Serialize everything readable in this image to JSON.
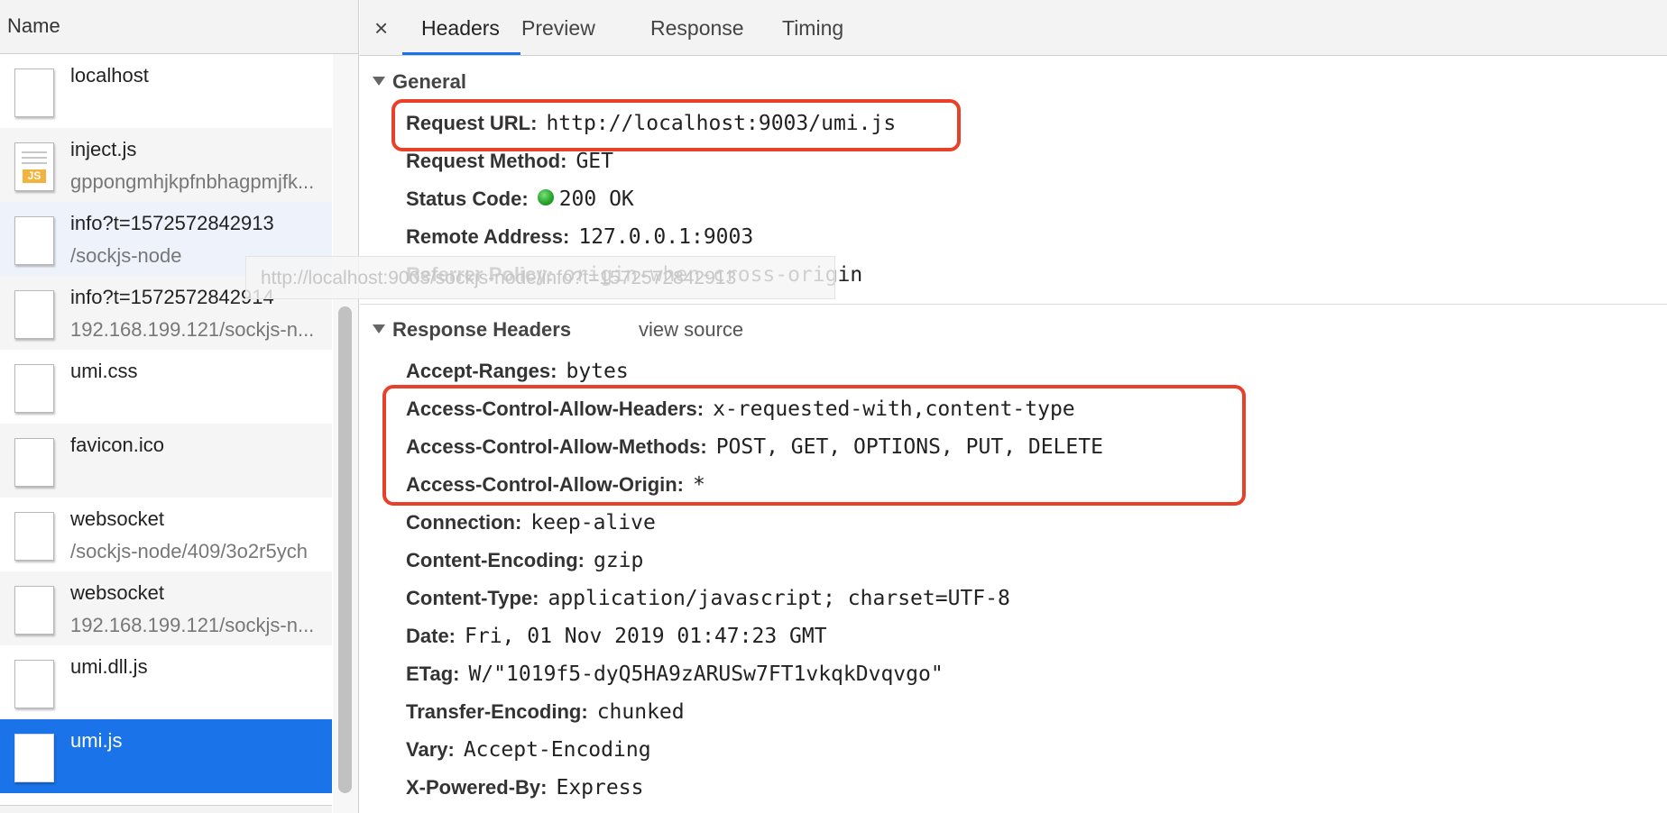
{
  "left_panel": {
    "column_header": "Name",
    "requests": [
      {
        "name": "localhost",
        "subtitle": "",
        "icon": "document-icon"
      },
      {
        "name": "inject.js",
        "subtitle": "gppongmhjkpfnbhagpmjfk...",
        "icon": "js-file-icon",
        "icon_badge": "JS"
      },
      {
        "name": "info?t=1572572842913",
        "subtitle": "/sockjs-node",
        "icon": "document-icon"
      },
      {
        "name": "info?t=1572572842914",
        "subtitle": "192.168.199.121/sockjs-n...",
        "icon": "document-icon"
      },
      {
        "name": "umi.css",
        "subtitle": "",
        "icon": "document-icon"
      },
      {
        "name": "favicon.ico",
        "subtitle": "",
        "icon": "document-icon"
      },
      {
        "name": "websocket",
        "subtitle": "/sockjs-node/409/3o2r5ych",
        "icon": "document-icon"
      },
      {
        "name": "websocket",
        "subtitle": "192.168.199.121/sockjs-n...",
        "icon": "document-icon"
      },
      {
        "name": "umi.dll.js",
        "subtitle": "",
        "icon": "document-icon"
      },
      {
        "name": "umi.js",
        "subtitle": "",
        "icon": "document-icon",
        "selected": true
      }
    ]
  },
  "tooltip": "http://localhost:9003/sockjs-node/info?t=1572572842913",
  "tabs": {
    "close_label": "×",
    "items": [
      "Headers",
      "Preview",
      "Response",
      "Timing"
    ],
    "active": "Headers"
  },
  "general": {
    "title": "General",
    "rows": [
      {
        "key": "Request URL:",
        "value": "http://localhost:9003/umi.js"
      },
      {
        "key": "Request Method:",
        "value": "GET"
      },
      {
        "key": "Status Code:",
        "value": "200 OK"
      },
      {
        "key": "Remote Address:",
        "value": "127.0.0.1:9003"
      },
      {
        "key": "Referrer Policy:",
        "value": "origin-when-cross-origin"
      }
    ]
  },
  "response_headers": {
    "title": "Response Headers",
    "view_source": "view source",
    "rows": [
      {
        "key": "Accept-Ranges:",
        "value": "bytes"
      },
      {
        "key": "Access-Control-Allow-Headers:",
        "value": "x-requested-with,content-type"
      },
      {
        "key": "Access-Control-Allow-Methods:",
        "value": "POST, GET, OPTIONS, PUT, DELETE"
      },
      {
        "key": "Access-Control-Allow-Origin:",
        "value": "*"
      },
      {
        "key": "Connection:",
        "value": "keep-alive"
      },
      {
        "key": "Content-Encoding:",
        "value": "gzip"
      },
      {
        "key": "Content-Type:",
        "value": "application/javascript; charset=UTF-8"
      },
      {
        "key": "Date:",
        "value": "Fri, 01 Nov 2019 01:47:23 GMT"
      },
      {
        "key": "ETag:",
        "value": "W/\"1019f5-dyQ5HA9zARUSw7FT1vkqkDvqvgo\""
      },
      {
        "key": "Transfer-Encoding:",
        "value": "chunked"
      },
      {
        "key": "Vary:",
        "value": "Accept-Encoding"
      },
      {
        "key": "X-Powered-By:",
        "value": "Express"
      }
    ]
  },
  "colors": {
    "selected_row": "#1a73e8",
    "highlight_box": "#e8412a",
    "status_ok": "#26a82b"
  }
}
